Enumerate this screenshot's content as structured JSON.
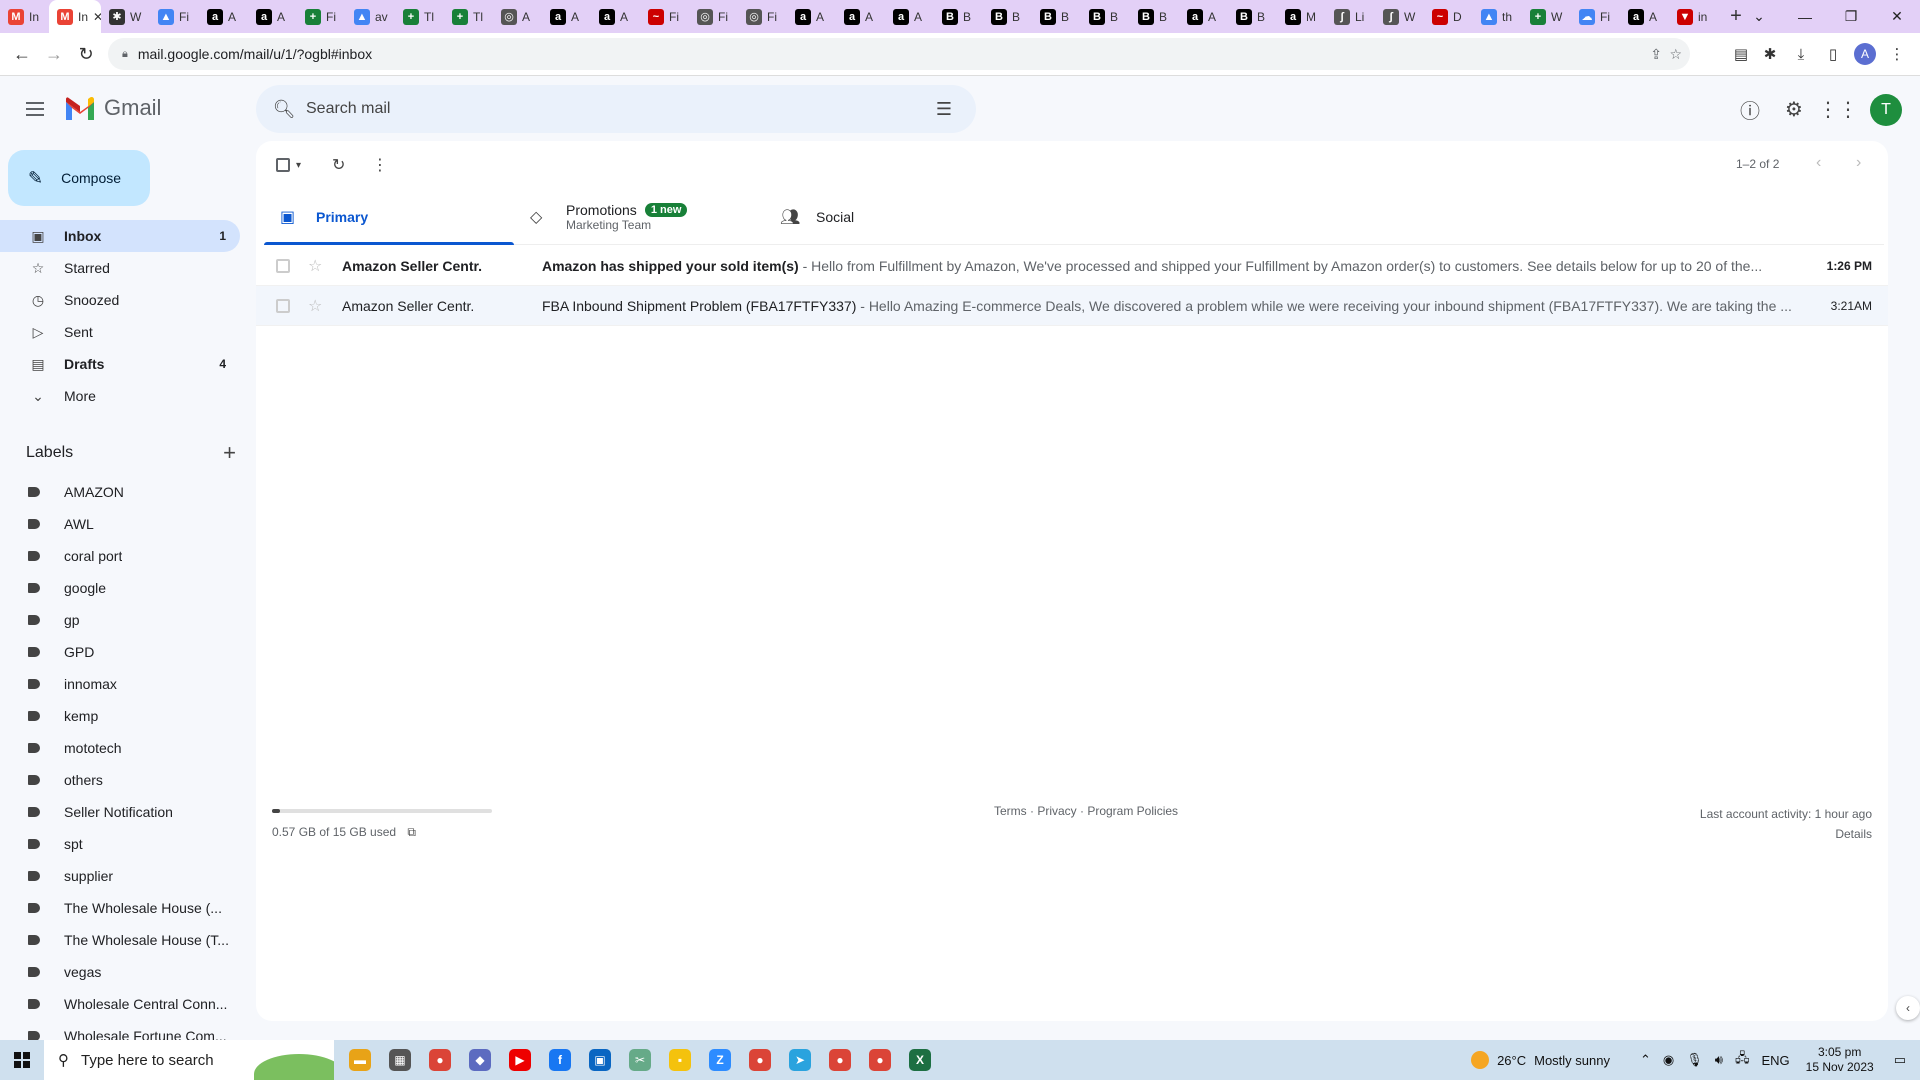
{
  "browser": {
    "tabs": [
      {
        "label": "In",
        "color": "#ea4335",
        "glyph": "M"
      },
      {
        "label": "In",
        "color": "#ea4335",
        "glyph": "M",
        "active": true
      },
      {
        "label": "W",
        "color": "#333",
        "glyph": "✱"
      },
      {
        "label": "Fi",
        "color": "#4285f4",
        "glyph": "▲"
      },
      {
        "label": "A",
        "color": "#000",
        "glyph": "a"
      },
      {
        "label": "A",
        "color": "#000",
        "glyph": "a"
      },
      {
        "label": "Fi",
        "color": "#188038",
        "glyph": "+"
      },
      {
        "label": "av",
        "color": "#4285f4",
        "glyph": "▲"
      },
      {
        "label": "Tl",
        "color": "#188038",
        "glyph": "+"
      },
      {
        "label": "Tl",
        "color": "#188038",
        "glyph": "+"
      },
      {
        "label": "A",
        "color": "#555",
        "glyph": "◎"
      },
      {
        "label": "A",
        "color": "#000",
        "glyph": "a"
      },
      {
        "label": "A",
        "color": "#000",
        "glyph": "a"
      },
      {
        "label": "Fi",
        "color": "#c00",
        "glyph": "~"
      },
      {
        "label": "Fi",
        "color": "#555",
        "glyph": "◎"
      },
      {
        "label": "Fi",
        "color": "#555",
        "glyph": "◎"
      },
      {
        "label": "A",
        "color": "#000",
        "glyph": "a"
      },
      {
        "label": "A",
        "color": "#000",
        "glyph": "a"
      },
      {
        "label": "A",
        "color": "#000",
        "glyph": "a"
      },
      {
        "label": "B",
        "color": "#000",
        "glyph": "B"
      },
      {
        "label": "B",
        "color": "#000",
        "glyph": "B"
      },
      {
        "label": "B",
        "color": "#000",
        "glyph": "B"
      },
      {
        "label": "B",
        "color": "#000",
        "glyph": "B"
      },
      {
        "label": "B",
        "color": "#000",
        "glyph": "B"
      },
      {
        "label": "A",
        "color": "#000",
        "glyph": "a"
      },
      {
        "label": "B",
        "color": "#000",
        "glyph": "B"
      },
      {
        "label": "M",
        "color": "#000",
        "glyph": "a"
      },
      {
        "label": "Li",
        "color": "#555",
        "glyph": "∫"
      },
      {
        "label": "W",
        "color": "#555",
        "glyph": "∫"
      },
      {
        "label": "D",
        "color": "#c00",
        "glyph": "~"
      },
      {
        "label": "th",
        "color": "#4285f4",
        "glyph": "▲"
      },
      {
        "label": "W",
        "color": "#188038",
        "glyph": "+"
      },
      {
        "label": "Fi",
        "color": "#4285f4",
        "glyph": "☁"
      },
      {
        "label": "A",
        "color": "#000",
        "glyph": "a"
      },
      {
        "label": "in",
        "color": "#c00",
        "glyph": "▼"
      }
    ],
    "url": "mail.google.com/mail/u/1/?ogbl#inbox"
  },
  "header": {
    "logo_text": "Gmail",
    "search_placeholder": "Search mail",
    "avatar_letter": "T",
    "avatar_color": "#1e8e3e"
  },
  "sidebar": {
    "compose_label": "Compose",
    "nav": [
      {
        "id": "inbox",
        "label": "Inbox",
        "count": "1",
        "icon": "▣",
        "active": true
      },
      {
        "id": "starred",
        "label": "Starred",
        "count": "",
        "icon": "☆"
      },
      {
        "id": "snoozed",
        "label": "Snoozed",
        "count": "",
        "icon": "◷"
      },
      {
        "id": "sent",
        "label": "Sent",
        "count": "",
        "icon": "▷"
      },
      {
        "id": "drafts",
        "label": "Drafts",
        "count": "4",
        "icon": "▤",
        "bold": true
      },
      {
        "id": "more",
        "label": "More",
        "count": "",
        "icon": "⌄"
      }
    ],
    "labels_title": "Labels",
    "labels": [
      "AMAZON",
      "AWL",
      "coral port",
      "google",
      "gp",
      "GPD",
      "innomax",
      "kemp",
      "mototech",
      "others",
      "Seller Notification",
      "spt",
      "supplier",
      "The Wholesale House (...",
      "The Wholesale House (T...",
      "vegas",
      "Wholesale Central Conn...",
      "Wholesale Fortune Com..."
    ]
  },
  "toolbar": {
    "pager_text": "1–2 of 2"
  },
  "tabs": {
    "primary_label": "Primary",
    "promotions_label": "Promotions",
    "promotions_badge": "1 new",
    "promotions_sub": "Marketing Team",
    "social_label": "Social"
  },
  "emails": [
    {
      "from": "Amazon Seller Centr.",
      "subject": "Amazon has shipped your sold item(s)",
      "snippet": " - Hello from Fulfillment by Amazon, We've processed and shipped your Fulfillment by Amazon order(s) to customers. See details below for up to 20 of the...",
      "time": "1:26 PM",
      "unread": true
    },
    {
      "from": "Amazon Seller Centr.",
      "subject": "FBA Inbound Shipment Problem (FBA17FTFY337)",
      "snippet": " - Hello Amazing E-commerce Deals, We discovered a problem while we were receiving your inbound shipment (FBA17FTFY337). We are taking the ...",
      "time": "3:21AM",
      "unread": false
    }
  ],
  "footer": {
    "storage_text": "0.57 GB of 15 GB used",
    "storage_fraction": 0.038,
    "links": "Terms · Privacy · Program Policies",
    "activity": "Last account activity: 1 hour ago",
    "details": "Details"
  },
  "taskbar": {
    "search_placeholder": "Type here to search",
    "apps": [
      {
        "name": "file-explorer",
        "color": "#e8a317",
        "glyph": "▬"
      },
      {
        "name": "calculator",
        "color": "#555",
        "glyph": "▦"
      },
      {
        "name": "chrome",
        "color": "#db4437",
        "glyph": "●"
      },
      {
        "name": "app-blue",
        "color": "#5c6bc0",
        "glyph": "◆"
      },
      {
        "name": "youtube",
        "color": "#e00",
        "glyph": "▶"
      },
      {
        "name": "facebook",
        "color": "#1877f2",
        "glyph": "f"
      },
      {
        "name": "store",
        "color": "#0a66c2",
        "glyph": "▣"
      },
      {
        "name": "snipping",
        "color": "#6a8",
        "glyph": "✂"
      },
      {
        "name": "sticky-notes",
        "color": "#f4c20d",
        "glyph": "▪"
      },
      {
        "name": "zoom",
        "color": "#2d8cff",
        "glyph": "Z"
      },
      {
        "name": "chrome-2",
        "color": "#db4437",
        "glyph": "●"
      },
      {
        "name": "telegram",
        "color": "#2aa3de",
        "glyph": "➤"
      },
      {
        "name": "chrome-3",
        "color": "#db4437",
        "glyph": "●"
      },
      {
        "name": "chrome-4",
        "color": "#db4437",
        "glyph": "●"
      },
      {
        "name": "excel",
        "color": "#1d6f42",
        "glyph": "X"
      }
    ],
    "weather_temp": "26°C",
    "weather_text": "Mostly sunny",
    "language": "ENG",
    "time": "3:05 pm",
    "date": "15 Nov 2023"
  }
}
